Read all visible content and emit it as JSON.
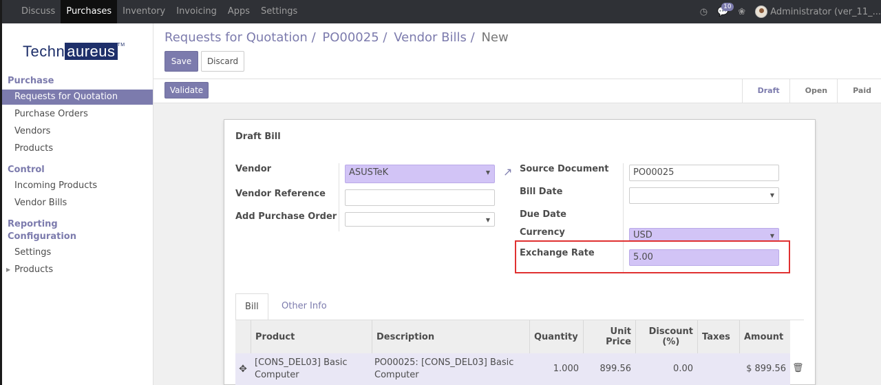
{
  "topbar": {
    "menu": [
      "Discuss",
      "Purchases",
      "Inventory",
      "Invoicing",
      "Apps",
      "Settings"
    ],
    "active": "Purchases",
    "messages_count": "10",
    "user": "Administrator (ver_11_..."
  },
  "sidebar": {
    "logo": {
      "part1": "Techn",
      "part2": "aureus",
      "tm": "TM"
    },
    "purchase_head": "Purchase",
    "purchase_items": [
      "Requests for Quotation",
      "Purchase Orders",
      "Vendors",
      "Products"
    ],
    "control_head": "Control",
    "control_items": [
      "Incoming Products",
      "Vendor Bills"
    ],
    "reporting_head": "Reporting",
    "configuration_head": "Configuration",
    "config_items": [
      "Settings",
      "Products"
    ]
  },
  "breadcrumb": {
    "items": [
      "Requests for Quotation",
      "PO00025",
      "Vendor Bills"
    ],
    "current": "New"
  },
  "buttons": {
    "save": "Save",
    "discard": "Discard",
    "validate": "Validate"
  },
  "stages": [
    "Draft",
    "Open",
    "Paid"
  ],
  "form": {
    "title": "Draft Bill",
    "vendor_label": "Vendor",
    "vendor_value": "ASUSTeK",
    "vendor_ref_label": "Vendor Reference",
    "vendor_ref_value": "",
    "add_po_label": "Add Purchase Order",
    "add_po_value": "",
    "source_doc_label": "Source Document",
    "source_doc_value": "PO00025",
    "bill_date_label": "Bill Date",
    "bill_date_value": "",
    "due_date_label": "Due Date",
    "currency_label": "Currency",
    "currency_value": "USD",
    "exchange_rate_label": "Exchange Rate",
    "exchange_rate_value": "5.00"
  },
  "tabs": [
    "Bill",
    "Other Info"
  ],
  "table": {
    "headers": {
      "product": "Product",
      "description": "Description",
      "quantity": "Quantity",
      "unit_price_1": "Unit",
      "unit_price_2": "Price",
      "discount_1": "Discount",
      "discount_2": "(%)",
      "taxes": "Taxes",
      "amount": "Amount"
    },
    "rows": [
      {
        "product_1": "[CONS_DEL03] Basic",
        "product_2": "Computer",
        "description_1": "PO00025: [CONS_DEL03] Basic",
        "description_2": "Computer",
        "quantity": "1.000",
        "unit_price": "899.56",
        "discount": "0.00",
        "taxes": "",
        "amount": "$ 899.56"
      }
    ]
  },
  "colors": {
    "brand": "#7c7bad",
    "required": "#d2c4f6",
    "highlight": "#e03030"
  }
}
